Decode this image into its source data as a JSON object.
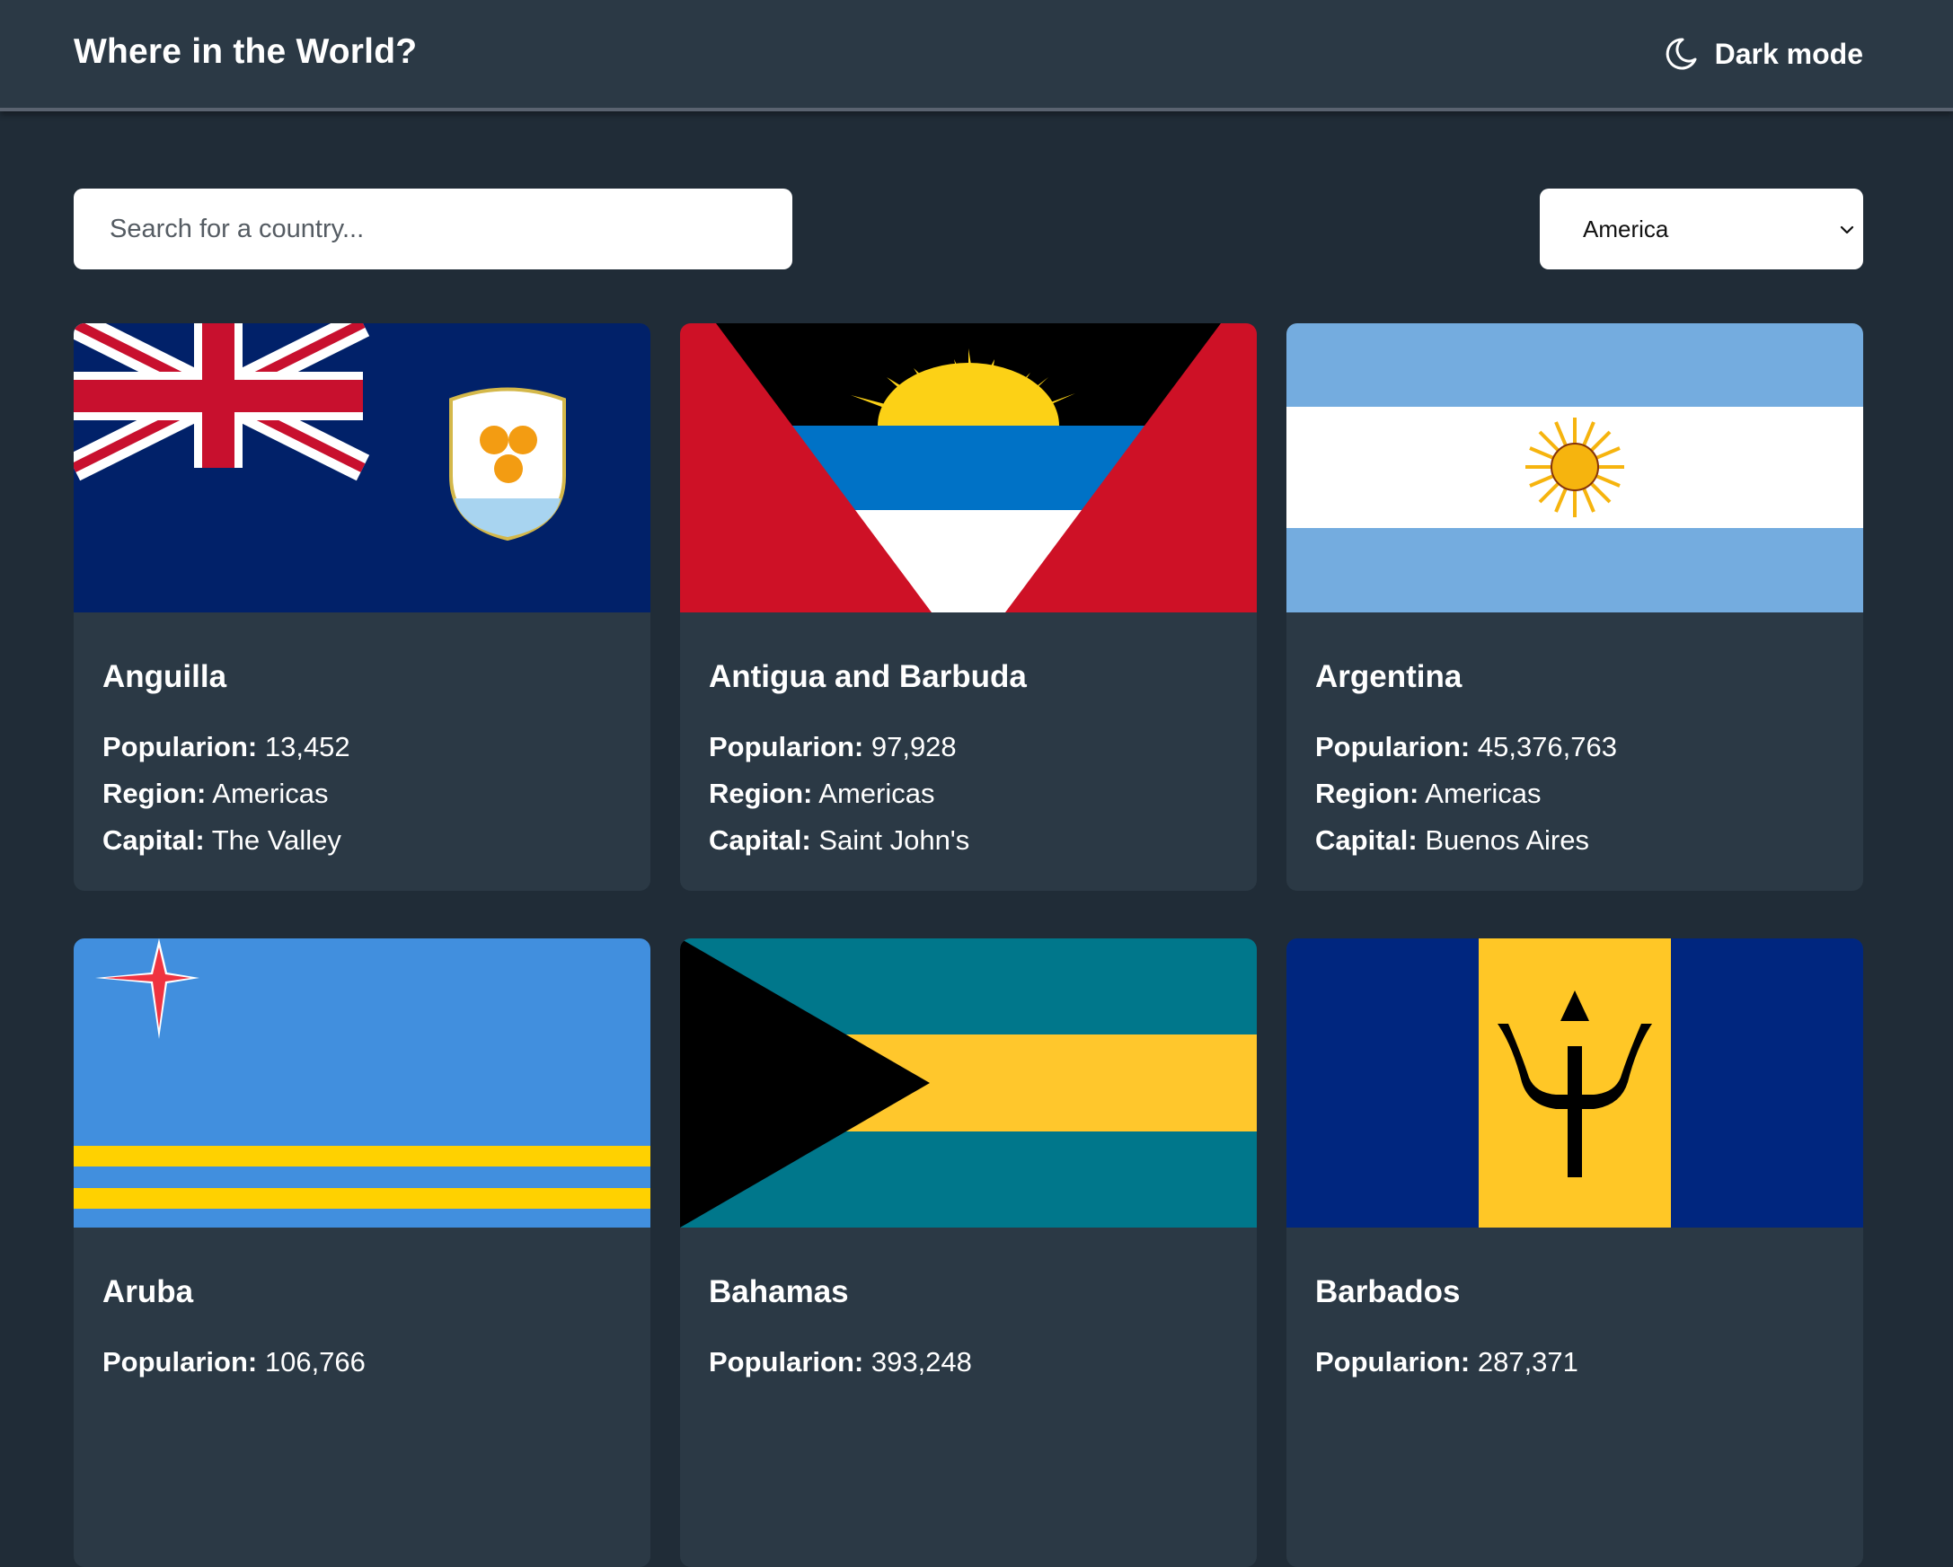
{
  "header": {
    "title": "Where in the World?",
    "theme_toggle": {
      "icon": "moon-icon",
      "label": "Dark mode"
    }
  },
  "search": {
    "placeholder": "Search for a country...",
    "value": ""
  },
  "region_filter": {
    "selected": "America"
  },
  "labels": {
    "population": "Popularion:",
    "region": "Region:",
    "capital": "Capital:"
  },
  "countries": [
    {
      "name": "Anguilla",
      "population": "13,452",
      "region": "Americas",
      "capital": "The Valley"
    },
    {
      "name": "Antigua and Barbuda",
      "population": "97,928",
      "region": "Americas",
      "capital": "Saint John's"
    },
    {
      "name": "Argentina",
      "population": "45,376,763",
      "region": "Americas",
      "capital": "Buenos Aires"
    },
    {
      "name": "Aruba",
      "population": "106,766"
    },
    {
      "name": "Bahamas",
      "population": "393,248"
    },
    {
      "name": "Barbados",
      "population": "287,371"
    }
  ],
  "colors": {
    "background": "#202c37",
    "elements": "#2b3945",
    "text": "#ffffff"
  }
}
